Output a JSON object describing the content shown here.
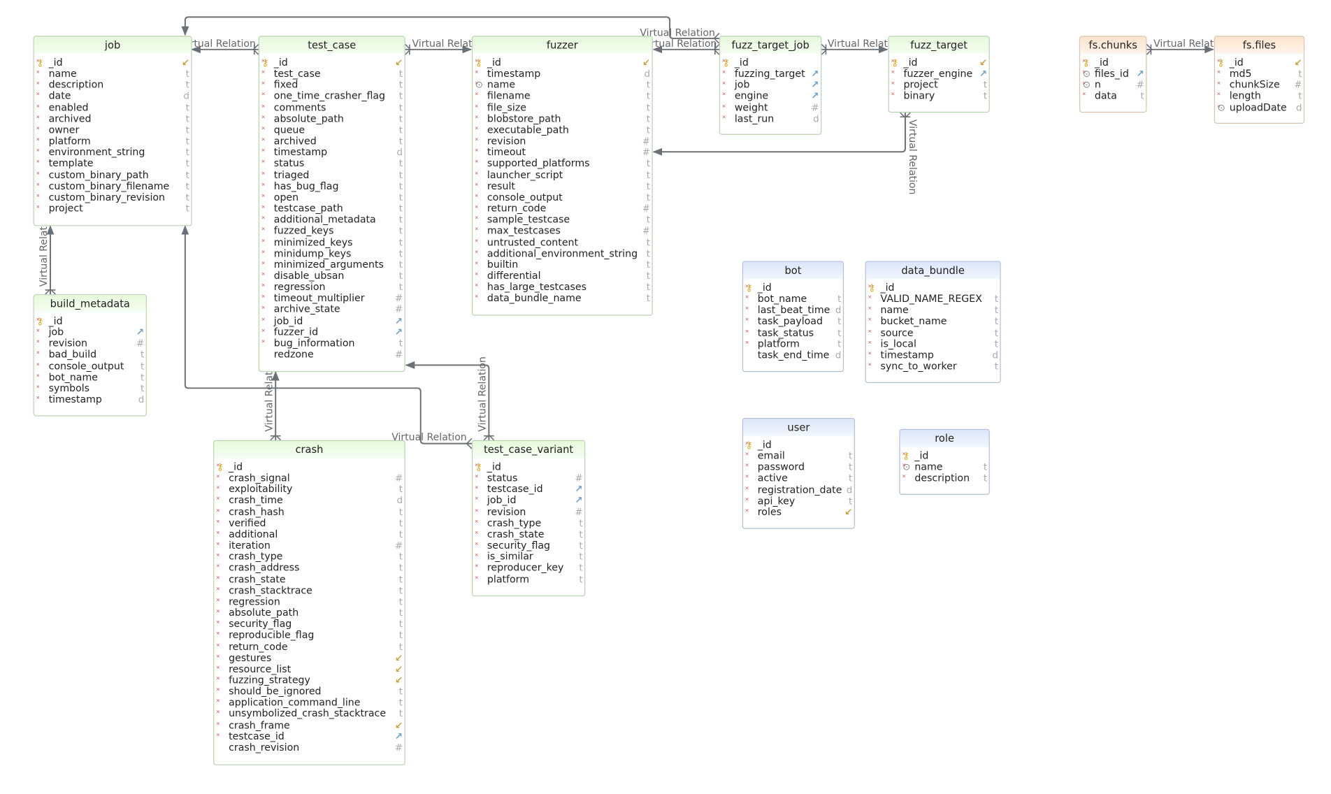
{
  "relation_label": "Virtual Relation",
  "colors": {
    "header_green": "#e6fadc",
    "header_blue": "#dbe6fa",
    "header_orange": "#fde4cc",
    "line": "#6b7075"
  },
  "type_glyphs": {
    "t": "t",
    "d": "d",
    "#": "#",
    "ref": "↗",
    "arr": "↙"
  },
  "icons": {
    "key": "key-icon",
    "index": "index-search-icon",
    "nullable": "not-null-marker"
  },
  "tables": {
    "job": {
      "title": "job",
      "style": "green",
      "fields": [
        [
          "_id",
          "arr",
          "key",
          1
        ],
        [
          "name",
          "t",
          "",
          1
        ],
        [
          "description",
          "t",
          "",
          1
        ],
        [
          "date",
          "d",
          "",
          1
        ],
        [
          "enabled",
          "t",
          "",
          1
        ],
        [
          "archived",
          "t",
          "",
          1
        ],
        [
          "owner",
          "t",
          "",
          1
        ],
        [
          "platform",
          "t",
          "",
          1
        ],
        [
          "environment_string",
          "t",
          "",
          1
        ],
        [
          "template",
          "t",
          "",
          1
        ],
        [
          "custom_binary_path",
          "t",
          "",
          1
        ],
        [
          "custom_binary_filename",
          "t",
          "",
          1
        ],
        [
          "custom_binary_revision",
          "t",
          "",
          1
        ],
        [
          "project",
          "t",
          "",
          1
        ]
      ]
    },
    "test_case": {
      "title": "test_case",
      "style": "green",
      "fields": [
        [
          "_id",
          "arr",
          "key",
          1
        ],
        [
          "test_case",
          "t",
          "",
          1
        ],
        [
          "fixed",
          "t",
          "",
          1
        ],
        [
          "one_time_crasher_flag",
          "t",
          "",
          1
        ],
        [
          "comments",
          "t",
          "",
          1
        ],
        [
          "absolute_path",
          "t",
          "",
          1
        ],
        [
          "queue",
          "t",
          "",
          1
        ],
        [
          "archived",
          "t",
          "",
          1
        ],
        [
          "timestamp",
          "d",
          "",
          1
        ],
        [
          "status",
          "t",
          "",
          1
        ],
        [
          "triaged",
          "t",
          "",
          1
        ],
        [
          "has_bug_flag",
          "t",
          "",
          1
        ],
        [
          "open",
          "t",
          "",
          1
        ],
        [
          "testcase_path",
          "t",
          "",
          1
        ],
        [
          "additional_metadata",
          "t",
          "",
          1
        ],
        [
          "fuzzed_keys",
          "t",
          "",
          1
        ],
        [
          "minimized_keys",
          "t",
          "",
          1
        ],
        [
          "minidump_keys",
          "t",
          "",
          1
        ],
        [
          "minimized_arguments",
          "t",
          "",
          1
        ],
        [
          "disable_ubsan",
          "t",
          "",
          1
        ],
        [
          "regression",
          "t",
          "",
          1
        ],
        [
          "timeout_multiplier",
          "#",
          "",
          1
        ],
        [
          "archive_state",
          "#",
          "",
          1
        ],
        [
          "job_id",
          "ref",
          "",
          1
        ],
        [
          "fuzzer_id",
          "ref",
          "",
          1
        ],
        [
          "bug_information",
          "t",
          "",
          1
        ],
        [
          "redzone",
          "#",
          "",
          0
        ]
      ]
    },
    "fuzzer": {
      "title": "fuzzer",
      "style": "green",
      "fields": [
        [
          "_id",
          "arr",
          "key",
          1
        ],
        [
          "timestamp",
          "d",
          "",
          1
        ],
        [
          "name",
          "t",
          "index",
          1
        ],
        [
          "filename",
          "t",
          "",
          1
        ],
        [
          "file_size",
          "t",
          "",
          1
        ],
        [
          "blobstore_path",
          "t",
          "",
          1
        ],
        [
          "executable_path",
          "t",
          "",
          1
        ],
        [
          "revision",
          "#",
          "",
          1
        ],
        [
          "timeout",
          "#",
          "",
          1
        ],
        [
          "supported_platforms",
          "t",
          "",
          1
        ],
        [
          "launcher_script",
          "t",
          "",
          1
        ],
        [
          "result",
          "t",
          "",
          1
        ],
        [
          "console_output",
          "t",
          "",
          1
        ],
        [
          "return_code",
          "#",
          "",
          1
        ],
        [
          "sample_testcase",
          "t",
          "",
          1
        ],
        [
          "max_testcases",
          "#",
          "",
          1
        ],
        [
          "untrusted_content",
          "t",
          "",
          1
        ],
        [
          "additional_environment_string",
          "t",
          "",
          1
        ],
        [
          "builtin",
          "t",
          "",
          1
        ],
        [
          "differential",
          "t",
          "",
          1
        ],
        [
          "has_large_testcases",
          "t",
          "",
          1
        ],
        [
          "data_bundle_name",
          "t",
          "",
          1
        ]
      ]
    },
    "fuzz_target_job": {
      "title": "fuzz_target_job",
      "style": "green",
      "fields": [
        [
          "_id",
          "",
          "key",
          1
        ],
        [
          "fuzzing_target",
          "ref",
          "",
          1
        ],
        [
          "job",
          "ref",
          "",
          1
        ],
        [
          "engine",
          "ref",
          "",
          1
        ],
        [
          "weight",
          "#",
          "",
          1
        ],
        [
          "last_run",
          "d",
          "",
          1
        ]
      ]
    },
    "fuzz_target": {
      "title": "fuzz_target",
      "style": "green",
      "fields": [
        [
          "_id",
          "arr",
          "key",
          1
        ],
        [
          "fuzzer_engine",
          "ref",
          "",
          1
        ],
        [
          "project",
          "t",
          "",
          1
        ],
        [
          "binary",
          "t",
          "",
          1
        ]
      ]
    },
    "fs_chunks": {
      "title": "fs.chunks",
      "style": "orange",
      "fields": [
        [
          "_id",
          "",
          "key",
          1
        ],
        [
          "files_id",
          "ref",
          "index",
          1
        ],
        [
          "n",
          "#",
          "index",
          1
        ],
        [
          "data",
          "t",
          "",
          1
        ]
      ]
    },
    "fs_files": {
      "title": "fs.files",
      "style": "orange",
      "fields": [
        [
          "_id",
          "arr",
          "key",
          1
        ],
        [
          "md5",
          "t",
          "",
          1
        ],
        [
          "chunkSize",
          "#",
          "",
          1
        ],
        [
          "length",
          "t",
          "",
          1
        ],
        [
          "uploadDate",
          "d",
          "index",
          1
        ]
      ]
    },
    "build_metadata": {
      "title": "build_metadata",
      "style": "green",
      "fields": [
        [
          "_id",
          "",
          "key",
          1
        ],
        [
          "job",
          "ref",
          "",
          1
        ],
        [
          "revision",
          "#",
          "",
          1
        ],
        [
          "bad_build",
          "t",
          "",
          1
        ],
        [
          "console_output",
          "t",
          "",
          1
        ],
        [
          "bot_name",
          "t",
          "",
          1
        ],
        [
          "symbols",
          "t",
          "",
          1
        ],
        [
          "timestamp",
          "d",
          "",
          1
        ]
      ]
    },
    "bot": {
      "title": "bot",
      "style": "blue",
      "fields": [
        [
          "_id",
          "",
          "key",
          1
        ],
        [
          "bot_name",
          "t",
          "",
          1
        ],
        [
          "last_beat_time",
          "d",
          "",
          1
        ],
        [
          "task_payload",
          "t",
          "",
          1
        ],
        [
          "task_status",
          "t",
          "",
          1
        ],
        [
          "platform",
          "t",
          "",
          1
        ],
        [
          "task_end_time",
          "d",
          "",
          0
        ]
      ]
    },
    "data_bundle": {
      "title": "data_bundle",
      "style": "blue",
      "fields": [
        [
          "_id",
          "",
          "key",
          1
        ],
        [
          "VALID_NAME_REGEX",
          "t",
          "",
          1
        ],
        [
          "name",
          "t",
          "",
          1
        ],
        [
          "bucket_name",
          "t",
          "",
          1
        ],
        [
          "source",
          "t",
          "",
          1
        ],
        [
          "is_local",
          "t",
          "",
          1
        ],
        [
          "timestamp",
          "d",
          "",
          1
        ],
        [
          "sync_to_worker",
          "t",
          "",
          1
        ]
      ]
    },
    "user": {
      "title": "user",
      "style": "blue",
      "fields": [
        [
          "_id",
          "",
          "key",
          1
        ],
        [
          "email",
          "t",
          "",
          1
        ],
        [
          "password",
          "t",
          "",
          1
        ],
        [
          "active",
          "t",
          "",
          1
        ],
        [
          "registration_date",
          "d",
          "",
          1
        ],
        [
          "api_key",
          "t",
          "",
          1
        ],
        [
          "roles",
          "arr",
          "",
          1
        ]
      ]
    },
    "role": {
      "title": "role",
      "style": "blue",
      "fields": [
        [
          "_id",
          "",
          "key",
          1
        ],
        [
          "name",
          "t",
          "index",
          1
        ],
        [
          "description",
          "t",
          "",
          1
        ]
      ]
    },
    "crash": {
      "title": "crash",
      "style": "green",
      "fields": [
        [
          "_id",
          "",
          "key",
          1
        ],
        [
          "crash_signal",
          "#",
          "",
          1
        ],
        [
          "exploitability",
          "t",
          "",
          1
        ],
        [
          "crash_time",
          "d",
          "",
          1
        ],
        [
          "crash_hash",
          "t",
          "",
          1
        ],
        [
          "verified",
          "t",
          "",
          1
        ],
        [
          "additional",
          "t",
          "",
          1
        ],
        [
          "iteration",
          "#",
          "",
          1
        ],
        [
          "crash_type",
          "t",
          "",
          1
        ],
        [
          "crash_address",
          "t",
          "",
          1
        ],
        [
          "crash_state",
          "t",
          "",
          1
        ],
        [
          "crash_stacktrace",
          "t",
          "",
          1
        ],
        [
          "regression",
          "t",
          "",
          1
        ],
        [
          "absolute_path",
          "t",
          "",
          1
        ],
        [
          "security_flag",
          "t",
          "",
          1
        ],
        [
          "reproducible_flag",
          "t",
          "",
          1
        ],
        [
          "return_code",
          "t",
          "",
          1
        ],
        [
          "gestures",
          "arr",
          "",
          1
        ],
        [
          "resource_list",
          "arr",
          "",
          1
        ],
        [
          "fuzzing_strategy",
          "arr",
          "",
          1
        ],
        [
          "should_be_ignored",
          "t",
          "",
          1
        ],
        [
          "application_command_line",
          "t",
          "",
          1
        ],
        [
          "unsymbolized_crash_stacktrace",
          "t",
          "",
          1
        ],
        [
          "crash_frame",
          "arr",
          "",
          1
        ],
        [
          "testcase_id",
          "ref",
          "",
          1
        ],
        [
          "crash_revision",
          "#",
          "",
          0
        ]
      ]
    },
    "test_case_variant": {
      "title": "test_case_variant",
      "style": "green",
      "fields": [
        [
          "_id",
          "",
          "key",
          1
        ],
        [
          "status",
          "#",
          "",
          1
        ],
        [
          "testcase_id",
          "ref",
          "",
          1
        ],
        [
          "job_id",
          "ref",
          "",
          1
        ],
        [
          "revision",
          "#",
          "",
          1
        ],
        [
          "crash_type",
          "t",
          "",
          1
        ],
        [
          "crash_state",
          "t",
          "",
          1
        ],
        [
          "security_flag",
          "t",
          "",
          1
        ],
        [
          "is_similar",
          "t",
          "",
          1
        ],
        [
          "reproducer_key",
          "t",
          "",
          1
        ],
        [
          "platform",
          "t",
          "",
          1
        ]
      ]
    }
  }
}
